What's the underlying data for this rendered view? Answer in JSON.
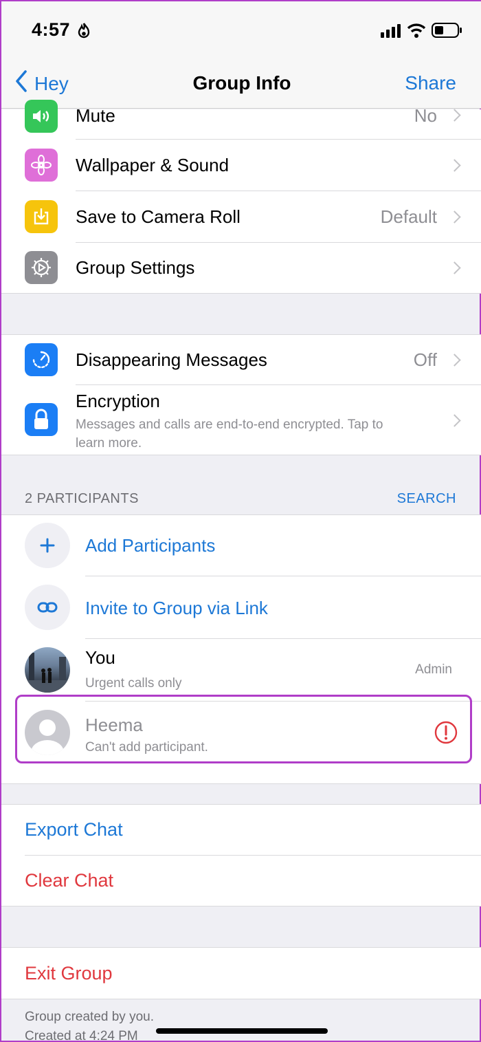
{
  "status_bar": {
    "time": "4:57"
  },
  "nav": {
    "back_label": "Hey",
    "title": "Group Info",
    "share_label": "Share"
  },
  "settings": {
    "mute": {
      "label": "Mute",
      "value": "No"
    },
    "wallpaper": {
      "label": "Wallpaper & Sound"
    },
    "save_camera_roll": {
      "label": "Save to Camera Roll",
      "value": "Default"
    },
    "group_settings": {
      "label": "Group Settings"
    }
  },
  "privacy": {
    "disappearing": {
      "label": "Disappearing Messages",
      "value": "Off"
    },
    "encryption": {
      "label": "Encryption",
      "line1": "Messages and calls are end-to-end encrypted. Tap to",
      "line2": "learn more."
    }
  },
  "participants": {
    "header": "2 PARTICIPANTS",
    "search_label": "SEARCH",
    "add_label": "Add Participants",
    "invite_label": "Invite to Group via Link",
    "members": [
      {
        "name": "You",
        "status": "Urgent calls only",
        "role": "Admin"
      },
      {
        "name": "Heema",
        "status": "Can't add participant."
      }
    ]
  },
  "actions": {
    "export": "Export Chat",
    "clear": "Clear Chat",
    "exit": "Exit Group"
  },
  "footer": {
    "line1": "Group created by you.",
    "line2": "Created at 4:24 PM"
  },
  "colors": {
    "accent": "#1d78d6",
    "destructive": "#e0383e",
    "highlight": "#b03dc8"
  }
}
